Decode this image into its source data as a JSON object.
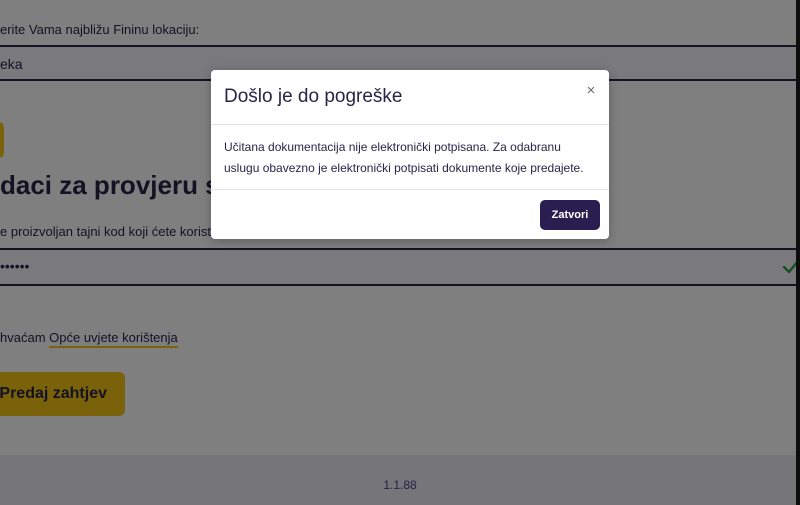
{
  "form": {
    "location_label": "erite Vama najbližu Fininu lokaciju:",
    "location_value": "eka",
    "section_title": "daci za provjeru stat",
    "code_label": "e proizvoljan tajni kod koji ćete koristiti",
    "code_value": "••••••",
    "terms_prefix": "hvaćam ",
    "terms_link": "Opće uvjete korištenja",
    "submit_label": "Predaj zahtjev"
  },
  "footer": {
    "version": "1.1.88"
  },
  "modal": {
    "title": "Došlo je do pogreške",
    "close_icon": "×",
    "body_line1": "Učitana dokumentacija nije elektronički potpisana. Za odabranu",
    "body_line2": "uslugu obavezno je elektronički potpisati dokumente koje predajete.",
    "close_button": "Zatvori"
  },
  "icons": {
    "check": "check-icon",
    "close": "close-icon"
  },
  "colors": {
    "accent_yellow": "#f2c515",
    "primary_dark": "#2a1d4f",
    "valid_green": "#2e9e3b"
  }
}
